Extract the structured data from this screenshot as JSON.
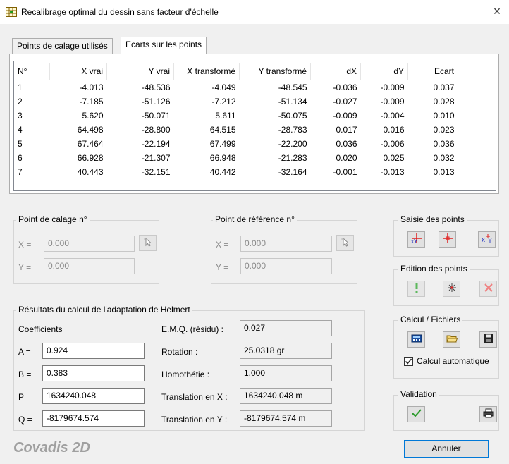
{
  "window": {
    "title": "Recalibrage optimal du dessin sans facteur d'échelle",
    "close": "×",
    "app_icon": "grid-calibration-icon"
  },
  "tabs": [
    {
      "label": "Points de calage utilisés",
      "active": false
    },
    {
      "label": "Ecarts sur les points",
      "active": true
    }
  ],
  "table": {
    "columns": [
      "N°",
      "X vrai",
      "Y vrai",
      "X transformé",
      "Y transformé",
      "dX",
      "dY",
      "Ecart"
    ],
    "rows": [
      [
        "1",
        "-4.013",
        "-48.536",
        "-4.049",
        "-48.545",
        "-0.036",
        "-0.009",
        "0.037"
      ],
      [
        "2",
        "-7.185",
        "-51.126",
        "-7.212",
        "-51.134",
        "-0.027",
        "-0.009",
        "0.028"
      ],
      [
        "3",
        "5.620",
        "-50.071",
        "5.611",
        "-50.075",
        "-0.009",
        "-0.004",
        "0.010"
      ],
      [
        "4",
        "64.498",
        "-28.800",
        "64.515",
        "-28.783",
        "0.017",
        "0.016",
        "0.023"
      ],
      [
        "5",
        "67.464",
        "-22.194",
        "67.499",
        "-22.200",
        "0.036",
        "-0.006",
        "0.036"
      ],
      [
        "6",
        "66.928",
        "-21.307",
        "66.948",
        "-21.283",
        "0.020",
        "0.025",
        "0.032"
      ],
      [
        "7",
        "40.443",
        "-32.151",
        "40.442",
        "-32.164",
        "-0.001",
        "-0.013",
        "0.013"
      ]
    ]
  },
  "calage": {
    "title": "Point de calage n°",
    "x_label": "X =",
    "x_value": "0.000",
    "y_label": "Y =",
    "y_value": "0.000",
    "pick_icon": "cursor-pick-icon"
  },
  "reference": {
    "title": "Point de référence n°",
    "x_label": "X =",
    "x_value": "0.000",
    "y_label": "Y =",
    "y_value": "0.000",
    "pick_icon": "cursor-pick-icon"
  },
  "helmert": {
    "title": "Résultats du calcul de l'adaptation de Helmert",
    "coefficients_label": "Coefficients",
    "a_label": "A =",
    "a_value": "0.924",
    "b_label": "B =",
    "b_value": "0.383",
    "p_label": "P =",
    "p_value": "1634240.048",
    "q_label": "Q =",
    "q_value": "-8179674.574",
    "emq_label": "E.M.Q. (résidu) :",
    "emq_value": "0.027",
    "rotation_label": "Rotation :",
    "rotation_value": "25.0318 gr",
    "homothetie_label": "Homothétie :",
    "homothetie_value": "1.000",
    "tx_label": "Translation en X :",
    "tx_value": "1634240.048 m",
    "ty_label": "Translation en Y :",
    "ty_value": "-8179674.574 m"
  },
  "saisie": {
    "title": "Saisie des points",
    "buttons": [
      "pick-xy-point-icon",
      "crosshair-point-icon",
      "enter-xy-icon"
    ]
  },
  "edition": {
    "title": "Edition des points",
    "buttons": [
      "exclamation-icon",
      "star-point-icon",
      "delete-x-icon"
    ]
  },
  "calcul": {
    "title": "Calcul / Fichiers",
    "buttons": [
      "calculator-icon",
      "open-folder-icon",
      "save-disk-icon"
    ],
    "auto_label": "Calcul automatique",
    "auto_checked": true
  },
  "validation": {
    "title": "Validation",
    "buttons": [
      "checkmark-icon",
      "printer-icon"
    ]
  },
  "footer": {
    "brand": "Covadis 2D",
    "cancel_label": "Annuler"
  },
  "colors": {
    "accent_blue": "#0078d7",
    "icon_red": "#e02020",
    "icon_blue": "#2030c0",
    "icon_green": "#2a9a2a",
    "icon_green_light": "#5cb85c"
  }
}
